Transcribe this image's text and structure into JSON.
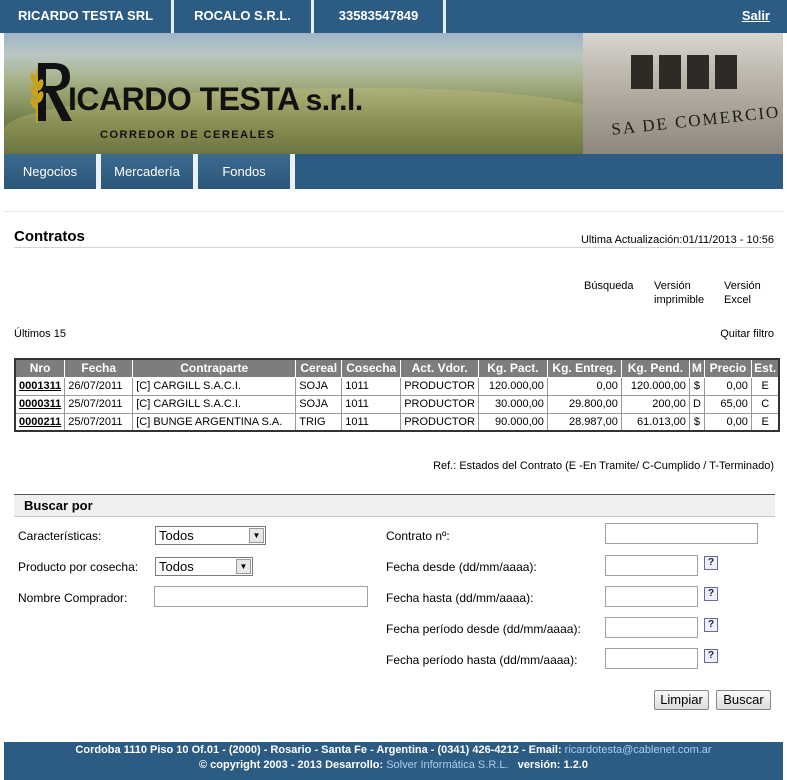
{
  "topbar": {
    "company1": "RICARDO TESTA SRL",
    "company2": "ROCALO S.R.L.",
    "account": "33583547849",
    "logout": "Salir"
  },
  "banner": {
    "brand": "ICARDO TESTA",
    "brand_suffix": "s.r.l.",
    "tagline": "CORREDOR DE CEREALES",
    "building_text": "SA DE COMERCIO"
  },
  "nav": {
    "items": [
      {
        "label": "Negocios"
      },
      {
        "label": "Mercadería"
      },
      {
        "label": "Fondos"
      }
    ]
  },
  "page": {
    "title": "Contratos",
    "updated": "Ultima Actualización:01/11/2013 - 10:56",
    "search_link": "Búsqueda",
    "print_link_1": "Versión",
    "print_link_2": "imprimible",
    "excel_link_1": "Versión",
    "excel_link_2": "Excel",
    "last_n": "Últimos 15",
    "clear_filter": "Quitar filtro",
    "reference": "Ref.: Estados del Contrato (E -En Tramite/ C-Cumplido / T-Terminado)"
  },
  "table": {
    "headers": [
      "Nro",
      "Fecha",
      "Contraparte",
      "Cereal",
      "Cosecha",
      "Act. Vdor.",
      "Kg. Pact.",
      "Kg. Entreg.",
      "Kg. Pend.",
      "M",
      "Precio",
      "Est."
    ],
    "rows": [
      [
        "0001311",
        "26/07/2011",
        "[C] CARGILL S.A.C.I.",
        "SOJA",
        "1011",
        "PRODUCTOR",
        "120.000,00",
        "0,00",
        "120.000,00",
        "$",
        "0,00",
        "E"
      ],
      [
        "0000311",
        "25/07/2011",
        "[C] CARGILL S.A.C.I.",
        "SOJA",
        "1011",
        "PRODUCTOR",
        "30.000,00",
        "29.800,00",
        "200,00",
        "D",
        "65,00",
        "C"
      ],
      [
        "0000211",
        "25/07/2011",
        "[C] BUNGE ARGENTINA S.A.",
        "TRIG",
        "1011",
        "PRODUCTOR",
        "90.000,00",
        "28.987,00",
        "61.013,00",
        "$",
        "0,00",
        "E"
      ]
    ]
  },
  "search": {
    "heading": "Buscar por",
    "caracteristicas_label": "Características:",
    "caracteristicas_value": "Todos",
    "producto_label": "Producto por cosecha:",
    "producto_value": "Todos",
    "comprador_label": "Nombre Comprador:",
    "comprador_value": "",
    "contrato_label": "Contrato nº:",
    "contrato_value": "",
    "fecha_desde_label": "Fecha desde (dd/mm/aaaa):",
    "fecha_hasta_label": "Fecha hasta (dd/mm/aaaa):",
    "periodo_desde_label": "Fecha período desde (dd/mm/aaaa):",
    "periodo_hasta_label": "Fecha período hasta (dd/mm/aaaa):",
    "help_symbol": "?",
    "clear_button": "Limpiar",
    "search_button": "Buscar"
  },
  "footer": {
    "address": "Cordoba 1110 Piso 10 Of.01 - (2000) - Rosario - Santa Fe - Argentina - (0341) 426-4212 - Email: ",
    "email": "ricardotesta@cablenet.com.ar",
    "copyright": "© copyright 2003 - 2013 Desarrollo: ",
    "developer": "Solver Informática S.R.L.",
    "version": "versión: 1.2.0"
  },
  "colors": {
    "primary_blue": "#2c5c84",
    "table_header": "#7d7d7d"
  }
}
